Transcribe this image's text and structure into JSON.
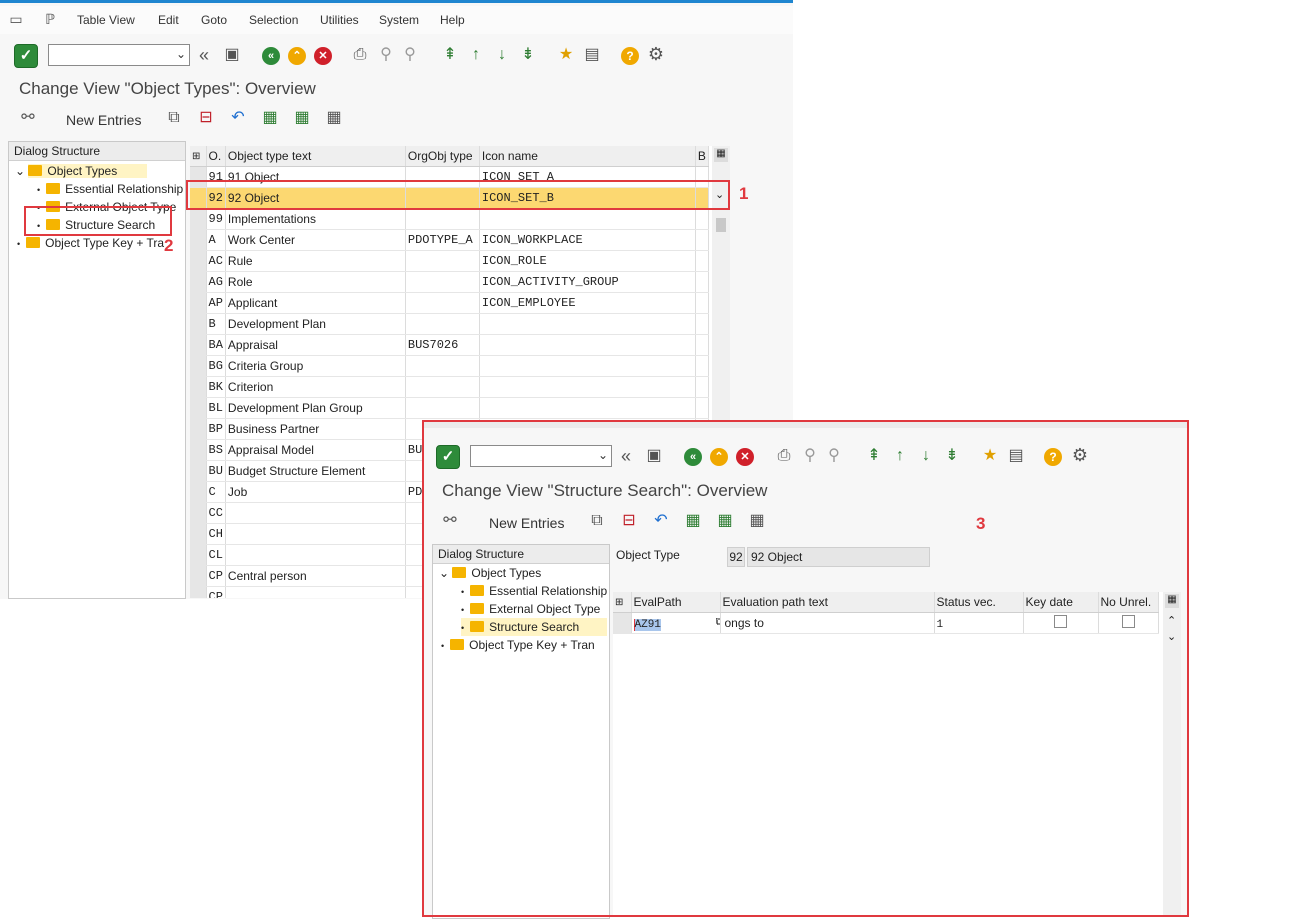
{
  "main": {
    "menu": [
      "Table View",
      "Edit",
      "Goto",
      "Selection",
      "Utilities",
      "System",
      "Help"
    ],
    "title": "Change View \"Object Types\": Overview",
    "app_toolbar": {
      "new_entries": "New Entries"
    },
    "dialog_structure": {
      "header": "Dialog Structure",
      "nodes": [
        {
          "label": "Object Types",
          "level": 0,
          "expanded": true,
          "selected": true
        },
        {
          "label": "Essential Relationship",
          "level": 1
        },
        {
          "label": "External Object Type",
          "level": 1
        },
        {
          "label": "Structure Search",
          "level": 1
        },
        {
          "label": "Object Type Key + Tra",
          "level": 0
        }
      ]
    },
    "table": {
      "columns": [
        "O.",
        "Object type text",
        "OrgObj type",
        "Icon name",
        "B"
      ],
      "rows": [
        {
          "code": "91",
          "text": "91 Object",
          "org": "",
          "icon": "ICON_SET_A"
        },
        {
          "code": "92",
          "text": "92 Object",
          "org": "",
          "icon": "ICON_SET_B",
          "selected": true
        },
        {
          "code": "99",
          "text": "Implementations",
          "org": "",
          "icon": ""
        },
        {
          "code": "A",
          "text": "Work Center",
          "org": "PDOTYPE_A",
          "icon": "ICON_WORKPLACE"
        },
        {
          "code": "AC",
          "text": "Rule",
          "org": "",
          "icon": "ICON_ROLE"
        },
        {
          "code": "AG",
          "text": "Role",
          "org": "",
          "icon": "ICON_ACTIVITY_GROUP"
        },
        {
          "code": "AP",
          "text": "Applicant",
          "org": "",
          "icon": "ICON_EMPLOYEE"
        },
        {
          "code": "B",
          "text": "Development Plan",
          "org": "",
          "icon": ""
        },
        {
          "code": "BA",
          "text": "Appraisal",
          "org": "BUS7026",
          "icon": ""
        },
        {
          "code": "BG",
          "text": "Criteria Group",
          "org": "",
          "icon": ""
        },
        {
          "code": "BK",
          "text": "Criterion",
          "org": "",
          "icon": ""
        },
        {
          "code": "BL",
          "text": "Development Plan Group",
          "org": "",
          "icon": ""
        },
        {
          "code": "BP",
          "text": "Business Partner",
          "org": "",
          "icon": ""
        },
        {
          "code": "BS",
          "text": "Appraisal Model",
          "org": "BU",
          "icon": ""
        },
        {
          "code": "BU",
          "text": "Budget Structure Element",
          "org": "",
          "icon": ""
        },
        {
          "code": "C",
          "text": "Job",
          "org": "PD",
          "icon": ""
        },
        {
          "code": "CC",
          "text": "",
          "org": "",
          "icon": ""
        },
        {
          "code": "CH",
          "text": "",
          "org": "",
          "icon": ""
        },
        {
          "code": "CL",
          "text": "",
          "org": "",
          "icon": ""
        },
        {
          "code": "CP",
          "text": "Central person",
          "org": "",
          "icon": ""
        },
        {
          "code": "CP",
          "text": "",
          "org": "",
          "icon": ""
        }
      ]
    }
  },
  "popup": {
    "title": "Change View \"Structure Search\": Overview",
    "app_toolbar": {
      "new_entries": "New Entries"
    },
    "dialog_structure": {
      "header": "Dialog Structure",
      "nodes": [
        {
          "label": "Object Types",
          "level": 0,
          "expanded": true
        },
        {
          "label": "Essential Relationship",
          "level": 1
        },
        {
          "label": "External Object Type",
          "level": 1
        },
        {
          "label": "Structure Search",
          "level": 1,
          "selected": true
        },
        {
          "label": "Object Type Key + Tran",
          "level": 0
        }
      ]
    },
    "object_type": {
      "label": "Object Type",
      "code": "92",
      "text": "92 Object"
    },
    "table": {
      "columns": [
        "EvalPath",
        "Evaluation path text",
        "Status vec.",
        "Key date",
        "No Unrel."
      ],
      "rows": [
        {
          "evalpath": "AZ91",
          "text": "ongs to",
          "status": "1",
          "key_date": false,
          "no_unrel": false
        }
      ]
    }
  },
  "callouts": [
    "1",
    "2",
    "3"
  ],
  "colors": {
    "accent": "#1f86d0",
    "highlight": "#fcd871",
    "annotation": "#e0393f",
    "folder": "#f5b400"
  }
}
